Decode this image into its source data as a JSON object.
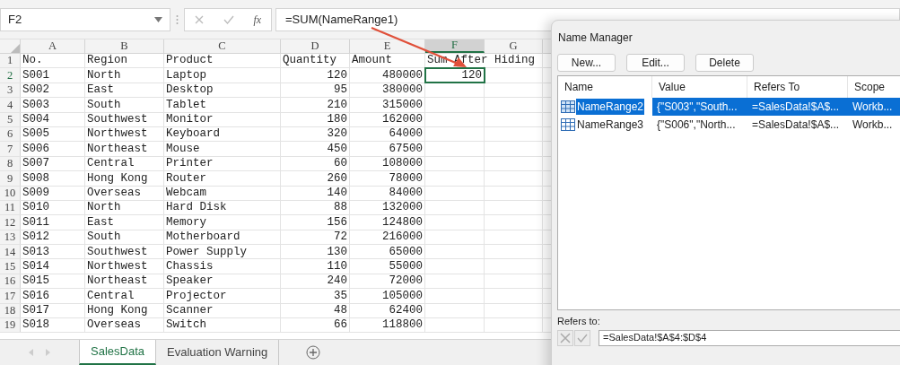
{
  "formula_bar": {
    "name_box": "F2",
    "fx": "fx",
    "formula": "=SUM(NameRange1)"
  },
  "columns": [
    {
      "label": "A",
      "selected": false
    },
    {
      "label": "B",
      "selected": false
    },
    {
      "label": "C",
      "selected": false
    },
    {
      "label": "D",
      "selected": false
    },
    {
      "label": "E",
      "selected": false
    },
    {
      "label": "F",
      "selected": true
    },
    {
      "label": "G",
      "selected": false
    }
  ],
  "rows": [
    {
      "num": "1",
      "selected": false,
      "cells": [
        "No.",
        "Region",
        "Product",
        "Quantity",
        "Amount",
        "Sum After Hiding",
        ""
      ]
    },
    {
      "num": "2",
      "selected": true,
      "cells": [
        "S001",
        "North",
        "Laptop",
        "120",
        "480000",
        "120",
        ""
      ]
    },
    {
      "num": "3",
      "selected": false,
      "cells": [
        "S002",
        "East",
        "Desktop",
        "95",
        "380000",
        "",
        ""
      ]
    },
    {
      "num": "4",
      "selected": false,
      "cells": [
        "S003",
        "South",
        "Tablet",
        "210",
        "315000",
        "",
        ""
      ]
    },
    {
      "num": "5",
      "selected": false,
      "cells": [
        "S004",
        "Southwest",
        "Monitor",
        "180",
        "162000",
        "",
        ""
      ]
    },
    {
      "num": "6",
      "selected": false,
      "cells": [
        "S005",
        "Northwest",
        "Keyboard",
        "320",
        "64000",
        "",
        ""
      ]
    },
    {
      "num": "7",
      "selected": false,
      "cells": [
        "S006",
        "Northeast",
        "Mouse",
        "450",
        "67500",
        "",
        ""
      ]
    },
    {
      "num": "8",
      "selected": false,
      "cells": [
        "S007",
        "Central",
        "Printer",
        "60",
        "108000",
        "",
        ""
      ]
    },
    {
      "num": "9",
      "selected": false,
      "cells": [
        "S008",
        "Hong Kong",
        "Router",
        "260",
        "78000",
        "",
        ""
      ]
    },
    {
      "num": "10",
      "selected": false,
      "cells": [
        "S009",
        "Overseas",
        "Webcam",
        "140",
        "84000",
        "",
        ""
      ]
    },
    {
      "num": "11",
      "selected": false,
      "cells": [
        "S010",
        "North",
        "Hard Disk",
        "88",
        "132000",
        "",
        ""
      ]
    },
    {
      "num": "12",
      "selected": false,
      "cells": [
        "S011",
        "East",
        "Memory",
        "156",
        "124800",
        "",
        ""
      ]
    },
    {
      "num": "13",
      "selected": false,
      "cells": [
        "S012",
        "South",
        "Motherboard",
        "72",
        "216000",
        "",
        ""
      ]
    },
    {
      "num": "14",
      "selected": false,
      "cells": [
        "S013",
        "Southwest",
        "Power Supply",
        "130",
        "65000",
        "",
        ""
      ]
    },
    {
      "num": "15",
      "selected": false,
      "cells": [
        "S014",
        "Northwest",
        "Chassis",
        "110",
        "55000",
        "",
        ""
      ]
    },
    {
      "num": "16",
      "selected": false,
      "cells": [
        "S015",
        "Northeast",
        "Speaker",
        "240",
        "72000",
        "",
        ""
      ]
    },
    {
      "num": "17",
      "selected": false,
      "cells": [
        "S016",
        "Central",
        "Projector",
        "35",
        "105000",
        "",
        ""
      ]
    },
    {
      "num": "18",
      "selected": false,
      "cells": [
        "S017",
        "Hong Kong",
        "Scanner",
        "48",
        "62400",
        "",
        ""
      ]
    },
    {
      "num": "19",
      "selected": false,
      "cells": [
        "S018",
        "Overseas",
        "Switch",
        "66",
        "118800",
        "",
        ""
      ]
    }
  ],
  "sheet_tabs": [
    {
      "label": "SalesData",
      "selected": true
    },
    {
      "label": "Evaluation Warning",
      "selected": false
    }
  ],
  "dialog": {
    "title": "Name Manager",
    "buttons": [
      "New...",
      "Edit...",
      "Delete"
    ],
    "columns": [
      "Name",
      "Value",
      "Refers To",
      "Scope"
    ],
    "rows": [
      {
        "cells": [
          "NameRange2",
          "{\"S003\",\"South...",
          "=SalesData!$A$...",
          "Workb..."
        ],
        "selected": true
      },
      {
        "cells": [
          "NameRange3",
          "{\"S006\",\"North...",
          "=SalesData!$A$...",
          "Workb..."
        ],
        "selected": false
      }
    ],
    "refers_label": "Refers to:",
    "refers_value": "=SalesData!$A$4:$D$4"
  }
}
